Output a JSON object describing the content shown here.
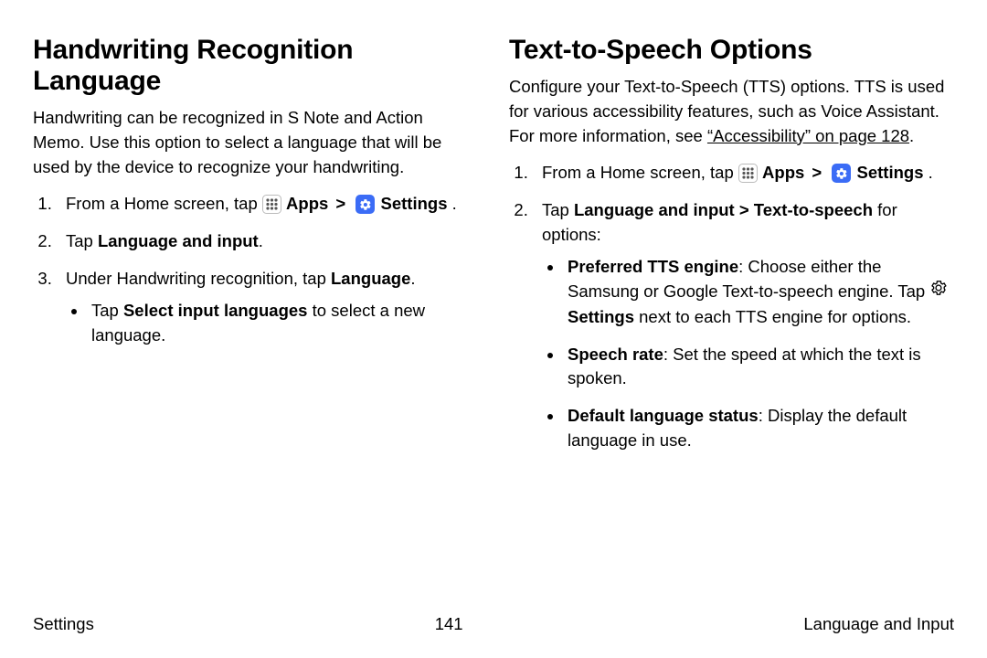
{
  "left": {
    "heading": "Handwriting Recognition Language",
    "intro": "Handwriting can be recognized in S Note and Action Memo. Use this option to select a language that will be used by the device to recognize your handwriting.",
    "step1_a": "From a Home screen, tap ",
    "apps": "Apps",
    "chev": ">",
    "settings": "Settings",
    "period": " .",
    "step2_a": "Tap ",
    "step2_b": "Language and input",
    "step2_c": ".",
    "step3_a": "Under Handwriting recognition, tap ",
    "step3_b": "Language",
    "step3_c": ".",
    "bullet1_a": "Tap ",
    "bullet1_b": "Select input languages",
    "bullet1_c": " to select a new language."
  },
  "right": {
    "heading": "Text-to-Speech Options",
    "intro_a": "Configure your Text-to-Speech (TTS) options. TTS is used for various accessibility features, such as Voice Assistant. For more information, see ",
    "intro_link": "“Accessibility” on page 128",
    "intro_c": ".",
    "step1_a": "From a Home screen, tap ",
    "apps": "Apps",
    "chev": ">",
    "settings": "Settings",
    "period": " .",
    "step2_a": "Tap ",
    "step2_b": "Language and input > Text-to-speech",
    "step2_c": " for options:",
    "b1_a": "Preferred TTS engine",
    "b1_b": ": Choose either the Samsung or Google Text-to-speech engine. Tap ",
    "b1_settings": "Settings",
    "b1_c": " next to each TTS engine for options.",
    "b2_a": "Speech rate",
    "b2_b": ": Set the speed at which the text is spoken.",
    "b3_a": "Default language status",
    "b3_b": ": Display the default language in use."
  },
  "footer": {
    "left": "Settings",
    "center": "141",
    "right": "Language and Input"
  }
}
